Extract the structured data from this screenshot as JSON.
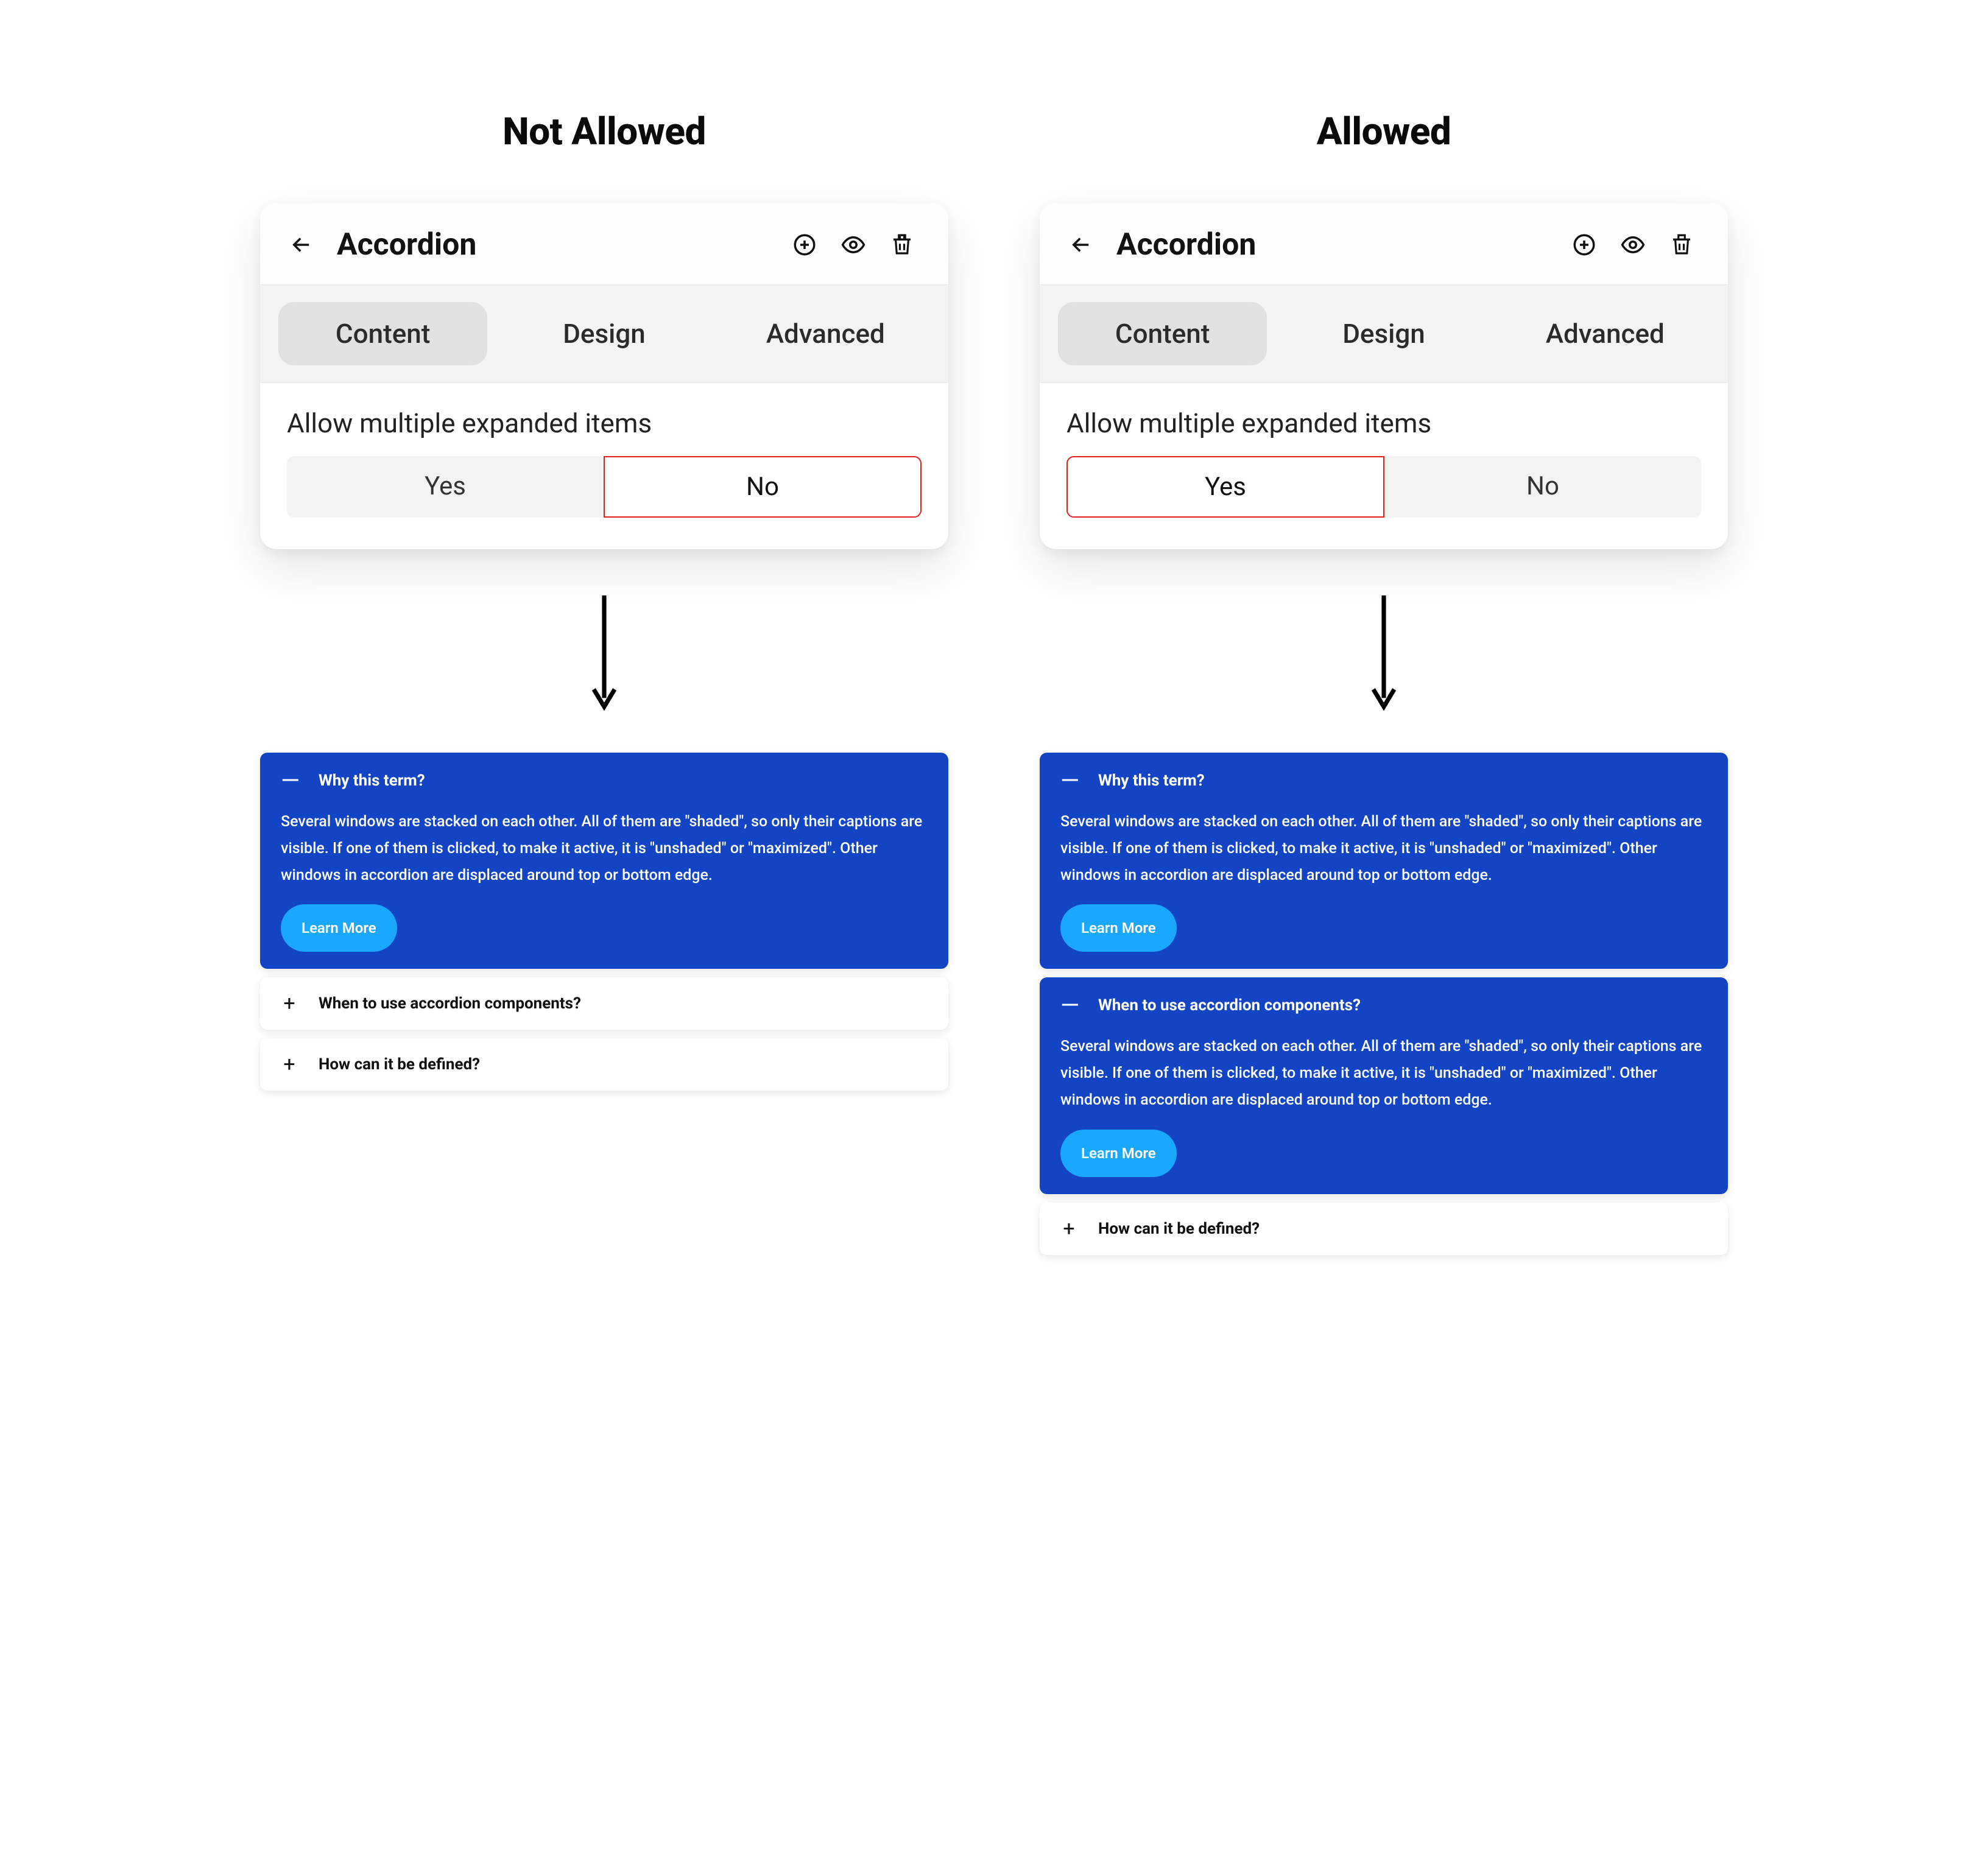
{
  "columns": {
    "not_allowed": {
      "heading": "Not Allowed"
    },
    "allowed": {
      "heading": "Allowed"
    }
  },
  "panel": {
    "title": "Accordion",
    "tabs": {
      "content": "Content",
      "design": "Design",
      "advanced": "Advanced"
    },
    "option_label": "Allow multiple expanded items",
    "yes": "Yes",
    "no": "No"
  },
  "accordion": {
    "item1_title": "Why this term?",
    "item2_title": "When to use accordion components?",
    "item3_title": "How can it be defined?",
    "body": "Several windows are stacked on each other. All of them are \"shaded\", so only their captions are visible. If one of them is clicked, to make it active, it is \"unshaded\" or \"maximized\". Other windows in accordion are displaced around top or bottom edge.",
    "learn_more": "Learn More"
  },
  "glyphs": {
    "plus": "+",
    "minus": "—"
  }
}
